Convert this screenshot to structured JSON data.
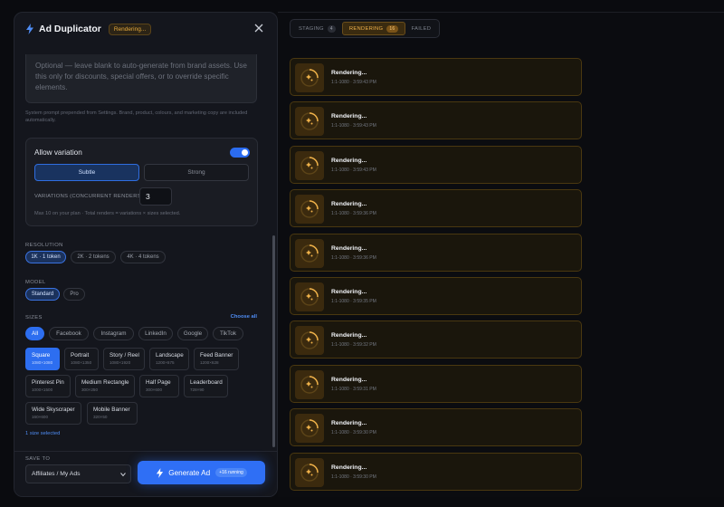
{
  "header": {
    "title": "Ad Duplicator",
    "status_badge": "Rendering..."
  },
  "prompt": {
    "placeholder_text": "Optional — leave blank to auto-generate from brand assets. Use this only for discounts, special offers, or to override specific elements.",
    "hint": "System prompt prepended from Settings. Brand, product, colours, and marketing copy are included automatically."
  },
  "variation": {
    "label": "Allow variation",
    "enabled": true,
    "options": [
      "Subtle",
      "Strong"
    ],
    "selected": "Subtle",
    "concurrent_label": "VARIATIONS (CONCURRENT RENDERS)",
    "concurrent_value": "3",
    "concurrent_hint": "Max 10 on your plan · Total renders = variations × sizes selected."
  },
  "resolution": {
    "label": "RESOLUTION",
    "options": [
      "1K · 1 token",
      "2K · 2 tokens",
      "4K · 4 tokens"
    ],
    "selected": "1K · 1 token"
  },
  "model": {
    "label": "MODEL",
    "options": [
      "Standard",
      "Pro"
    ],
    "selected": "Standard"
  },
  "sizes": {
    "label": "SIZES",
    "choose_all": "Choose all",
    "tabs": [
      "All",
      "Facebook",
      "Instagram",
      "LinkedIn",
      "Google",
      "TikTok"
    ],
    "active_tab": "All",
    "items": [
      {
        "name": "Square",
        "dims": "1080×1080",
        "selected": true
      },
      {
        "name": "Portrait",
        "dims": "1080×1350",
        "selected": false
      },
      {
        "name": "Story / Reel",
        "dims": "1080×1920",
        "selected": false
      },
      {
        "name": "Landscape",
        "dims": "1200×675",
        "selected": false
      },
      {
        "name": "Feed Banner",
        "dims": "1200×628",
        "selected": false
      },
      {
        "name": "Pinterest Pin",
        "dims": "1000×1500",
        "selected": false
      },
      {
        "name": "Medium Rectangle",
        "dims": "300×250",
        "selected": false
      },
      {
        "name": "Half Page",
        "dims": "300×600",
        "selected": false
      },
      {
        "name": "Leaderboard",
        "dims": "728×90",
        "selected": false
      },
      {
        "name": "Wide Skyscraper",
        "dims": "160×600",
        "selected": false
      },
      {
        "name": "Mobile Banner",
        "dims": "320×50",
        "selected": false
      }
    ],
    "selected_count_text": "1 size selected"
  },
  "footer": {
    "save_label": "SAVE TO",
    "save_value": "Affiliates / My Ads",
    "generate_label": "Generate Ad",
    "running_badge": "+16 running"
  },
  "queue": {
    "tabs": [
      {
        "label": "STAGING",
        "count": "4",
        "active": false
      },
      {
        "label": "RENDERING",
        "count": "16",
        "active": true
      },
      {
        "label": "FAILED",
        "count": "",
        "active": false
      }
    ],
    "items": [
      {
        "title": "Rendering...",
        "meta": "1:1-1080 · 3:59:43 PM"
      },
      {
        "title": "Rendering...",
        "meta": "1:1-1080 · 3:59:43 PM"
      },
      {
        "title": "Rendering...",
        "meta": "1:1-1080 · 3:59:43 PM"
      },
      {
        "title": "Rendering...",
        "meta": "1:1-1080 · 3:59:36 PM"
      },
      {
        "title": "Rendering...",
        "meta": "1:1-1080 · 3:59:36 PM"
      },
      {
        "title": "Rendering...",
        "meta": "1:1-1080 · 3:59:35 PM"
      },
      {
        "title": "Rendering...",
        "meta": "1:1-1080 · 3:59:32 PM"
      },
      {
        "title": "Rendering...",
        "meta": "1:1-1080 · 3:59:31 PM"
      },
      {
        "title": "Rendering...",
        "meta": "1:1-1080 · 3:59:30 PM"
      },
      {
        "title": "Rendering...",
        "meta": "1:1-1080 · 3:59:30 PM"
      }
    ]
  },
  "colors": {
    "accent": "#2f6ff5",
    "rendering": "#f0b24a",
    "panel": "#14161d"
  }
}
